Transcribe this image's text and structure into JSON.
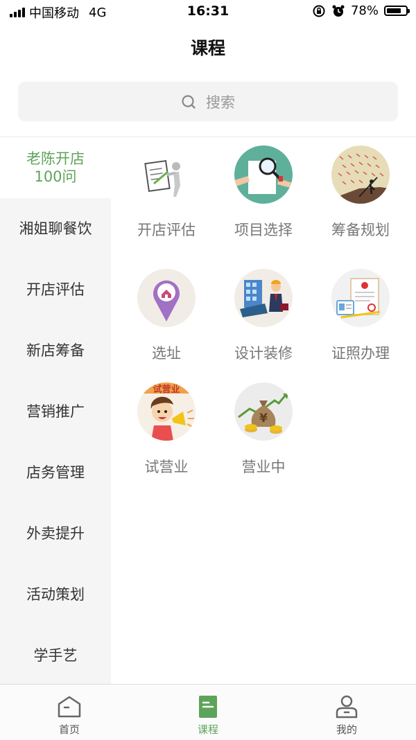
{
  "status_bar": {
    "carrier": "中国移动",
    "network": "4G",
    "time": "16:31",
    "battery": "78%",
    "battery_level": 0.78
  },
  "header": {
    "title": "课程"
  },
  "search": {
    "placeholder": "搜索"
  },
  "sidebar": {
    "items": [
      {
        "label": "老陈开店100问",
        "active": true
      },
      {
        "label": "湘姐聊餐饮",
        "active": false
      },
      {
        "label": "开店评估",
        "active": false
      },
      {
        "label": "新店筹备",
        "active": false
      },
      {
        "label": "营销推广",
        "active": false
      },
      {
        "label": "店务管理",
        "active": false
      },
      {
        "label": "外卖提升",
        "active": false
      },
      {
        "label": "活动策划",
        "active": false
      },
      {
        "label": "学手艺",
        "active": false
      }
    ]
  },
  "grid": {
    "items": [
      {
        "label": "开店评估",
        "icon": "evaluation-icon"
      },
      {
        "label": "项目选择",
        "icon": "project-selection-icon"
      },
      {
        "label": "筹备规划",
        "icon": "planning-icon"
      },
      {
        "label": "选址",
        "icon": "location-pin-icon"
      },
      {
        "label": "设计装修",
        "icon": "design-decoration-icon"
      },
      {
        "label": "证照办理",
        "icon": "license-icon"
      },
      {
        "label": "试营业",
        "icon": "trial-operation-icon",
        "badge_text": "试营业"
      },
      {
        "label": "营业中",
        "icon": "money-bag-icon"
      }
    ]
  },
  "tabbar": {
    "items": [
      {
        "label": "首页",
        "icon": "home-icon",
        "active": false
      },
      {
        "label": "课程",
        "icon": "course-book-icon",
        "active": true
      },
      {
        "label": "我的",
        "icon": "user-icon",
        "active": false
      }
    ]
  },
  "colors": {
    "accent": "#5ea35a",
    "sidebar_bg": "#f5f5f5",
    "search_bg": "#f3f3f3"
  }
}
